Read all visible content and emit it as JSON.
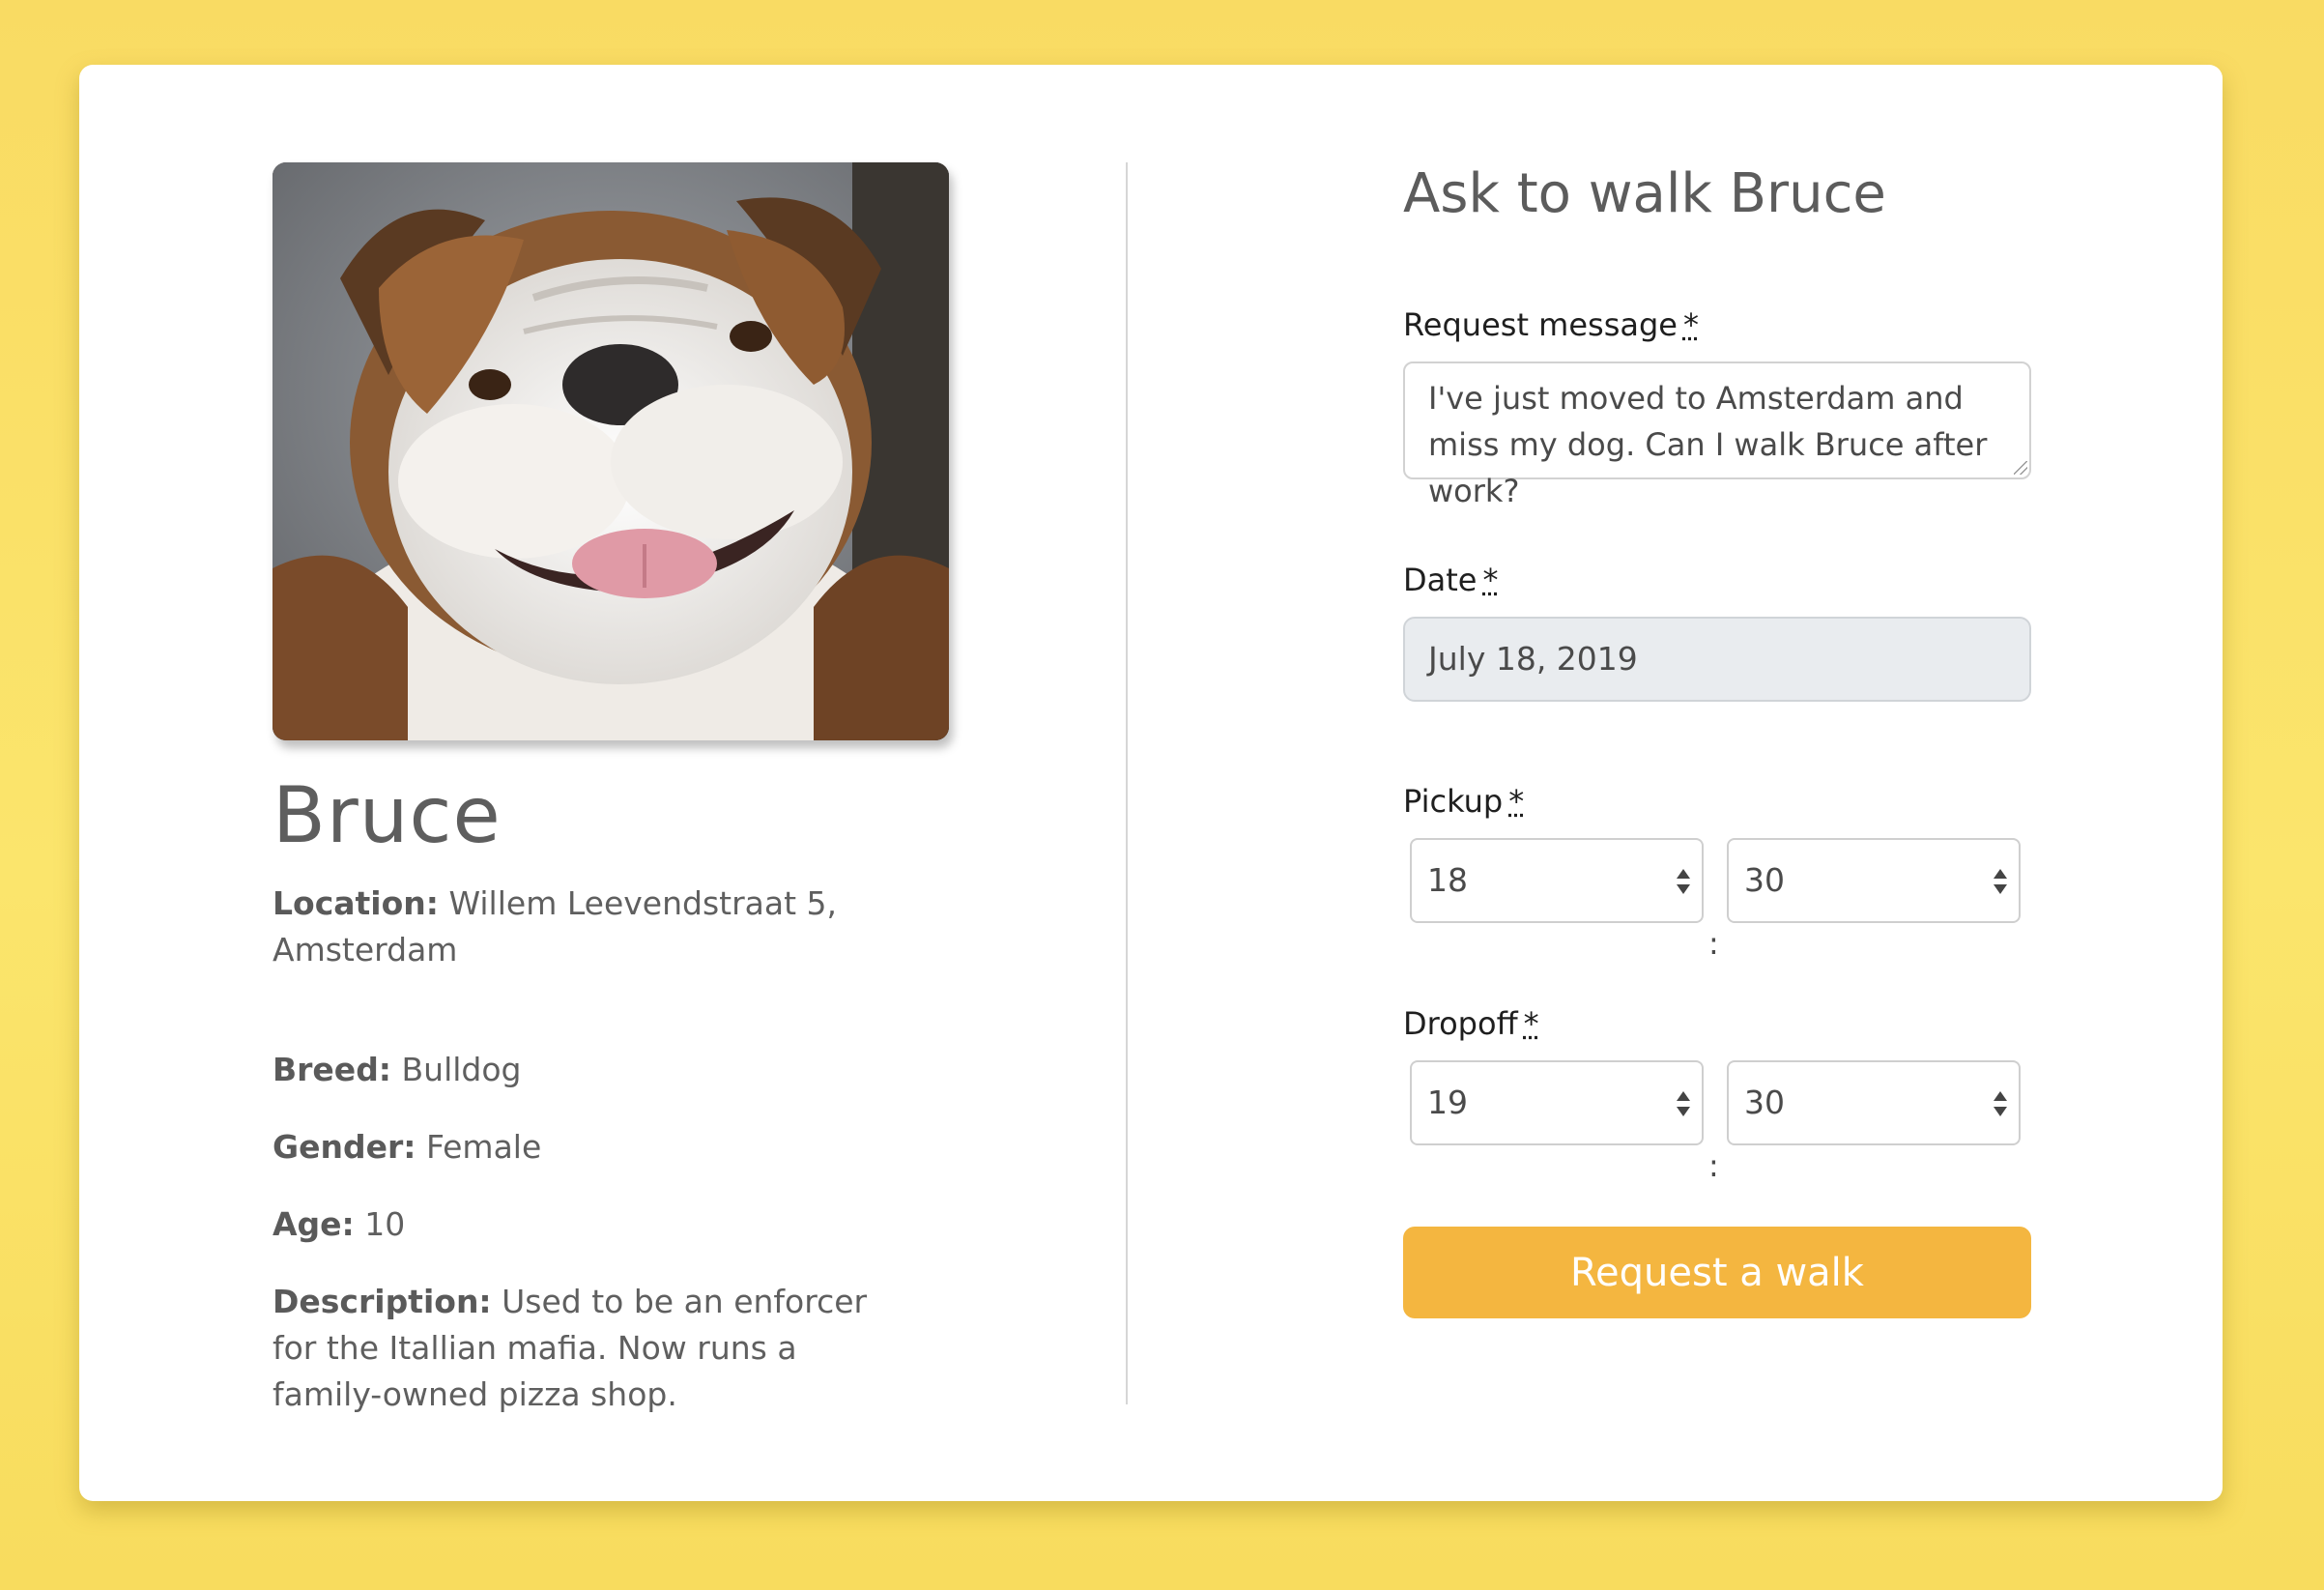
{
  "dog": {
    "name": "Bruce",
    "photo_alt": "Bulldog photo",
    "location_label": "Location:",
    "location_value": "Willem Leevendstraat 5, Amsterdam",
    "breed_label": "Breed:",
    "breed_value": "Bulldog",
    "gender_label": "Gender:",
    "gender_value": "Female",
    "age_label": "Age:",
    "age_value": "10",
    "description_label": "Description:",
    "description_value": "Used to be an enforcer for the Itallian mafia. Now runs a family-owned pizza shop."
  },
  "form": {
    "title": "Ask to walk Bruce",
    "message_label": "Request message",
    "message_value": "I've just moved to Amsterdam and miss my dog. Can I walk Bruce after work?",
    "date_label": "Date",
    "date_value": "July 18, 2019",
    "pickup_label": "Pickup",
    "pickup_hour": "18",
    "pickup_minute": "30",
    "dropoff_label": "Dropoff",
    "dropoff_hour": "19",
    "dropoff_minute": "30",
    "time_separator": ":",
    "required_mark": "*",
    "submit_label": "Request a walk"
  },
  "colors": {
    "background": "#f9dc62",
    "accent": "#f4b640",
    "card": "#ffffff"
  }
}
